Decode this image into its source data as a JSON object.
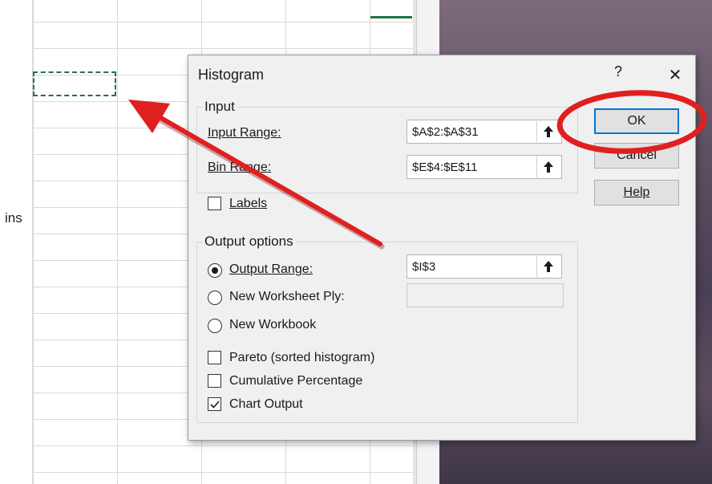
{
  "sheet": {
    "cell_text": "ins"
  },
  "dialog": {
    "title": "Histogram",
    "help_glyph": "?",
    "close_glyph": "✕",
    "input_group": {
      "legend": "Input",
      "input_range_label": "Input Range:",
      "input_range_value": "$A$2:$A$31",
      "bin_range_label": "Bin Range:",
      "bin_range_value": "$E$4:$E$11",
      "labels_checkbox": "Labels"
    },
    "output_group": {
      "legend": "Output options",
      "output_range_label": "Output Range:",
      "output_range_value": "$I$3",
      "new_worksheet_label": "New Worksheet Ply:",
      "new_workbook_label": "New Workbook",
      "pareto_label": "Pareto (sorted histogram)",
      "cumulative_label": "Cumulative Percentage",
      "chart_output_label": "Chart Output"
    },
    "buttons": {
      "ok": "OK",
      "cancel": "Cancel",
      "help": "Help"
    },
    "state": {
      "selected_output_option": "Output Range",
      "labels_checked": false,
      "pareto_checked": false,
      "cumulative_checked": false,
      "chart_output_checked": true
    }
  },
  "annotation": {
    "arrow_color": "#e02020",
    "highlight_color": "#e02020",
    "highlight_target": "OK button"
  },
  "colors": {
    "accent_blue": "#0078d7",
    "excel_green": "#217346",
    "dialog_bg": "#f0f0f0"
  }
}
